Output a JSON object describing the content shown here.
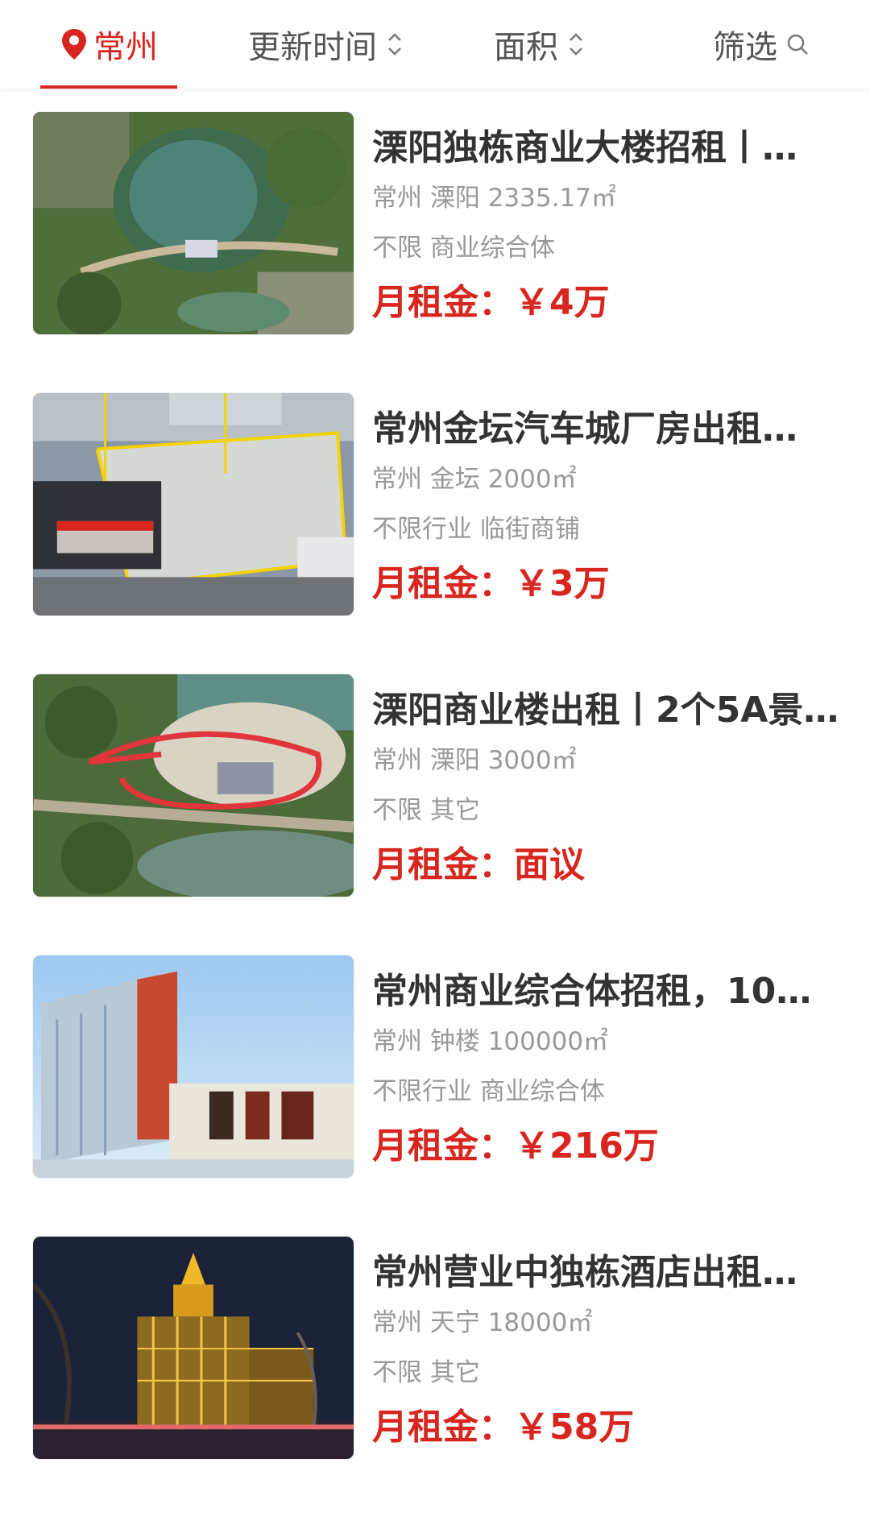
{
  "filters": {
    "city": "常州",
    "update_time": "更新时间",
    "area": "面积",
    "filter": "筛选"
  },
  "accent_color": "#d8261f",
  "listings": [
    {
      "title": "溧阳独栋商业大楼招租丨…",
      "location": "常州 溧阳 2335.17㎡",
      "tags": "不限 商业综合体",
      "rent_label": "月租金：",
      "rent_value": "￥4万"
    },
    {
      "title": "常州金坛汽车城厂房出租…",
      "location": "常州 金坛 2000㎡",
      "tags": "不限行业 临街商铺",
      "rent_label": "月租金：",
      "rent_value": "￥3万"
    },
    {
      "title": "溧阳商业楼出租丨2个5A景…",
      "location": "常州 溧阳 3000㎡",
      "tags": "不限 其它",
      "rent_label": "月租金：",
      "rent_value": "面议"
    },
    {
      "title": "常州商业综合体招租，10…",
      "location": "常州 钟楼 100000㎡",
      "tags": "不限行业 商业综合体",
      "rent_label": "月租金：",
      "rent_value": "￥216万"
    },
    {
      "title": "常州营业中独栋酒店出租…",
      "location": "常州 天宁 18000㎡",
      "tags": "不限 其它",
      "rent_label": "月租金：",
      "rent_value": "￥58万"
    }
  ]
}
